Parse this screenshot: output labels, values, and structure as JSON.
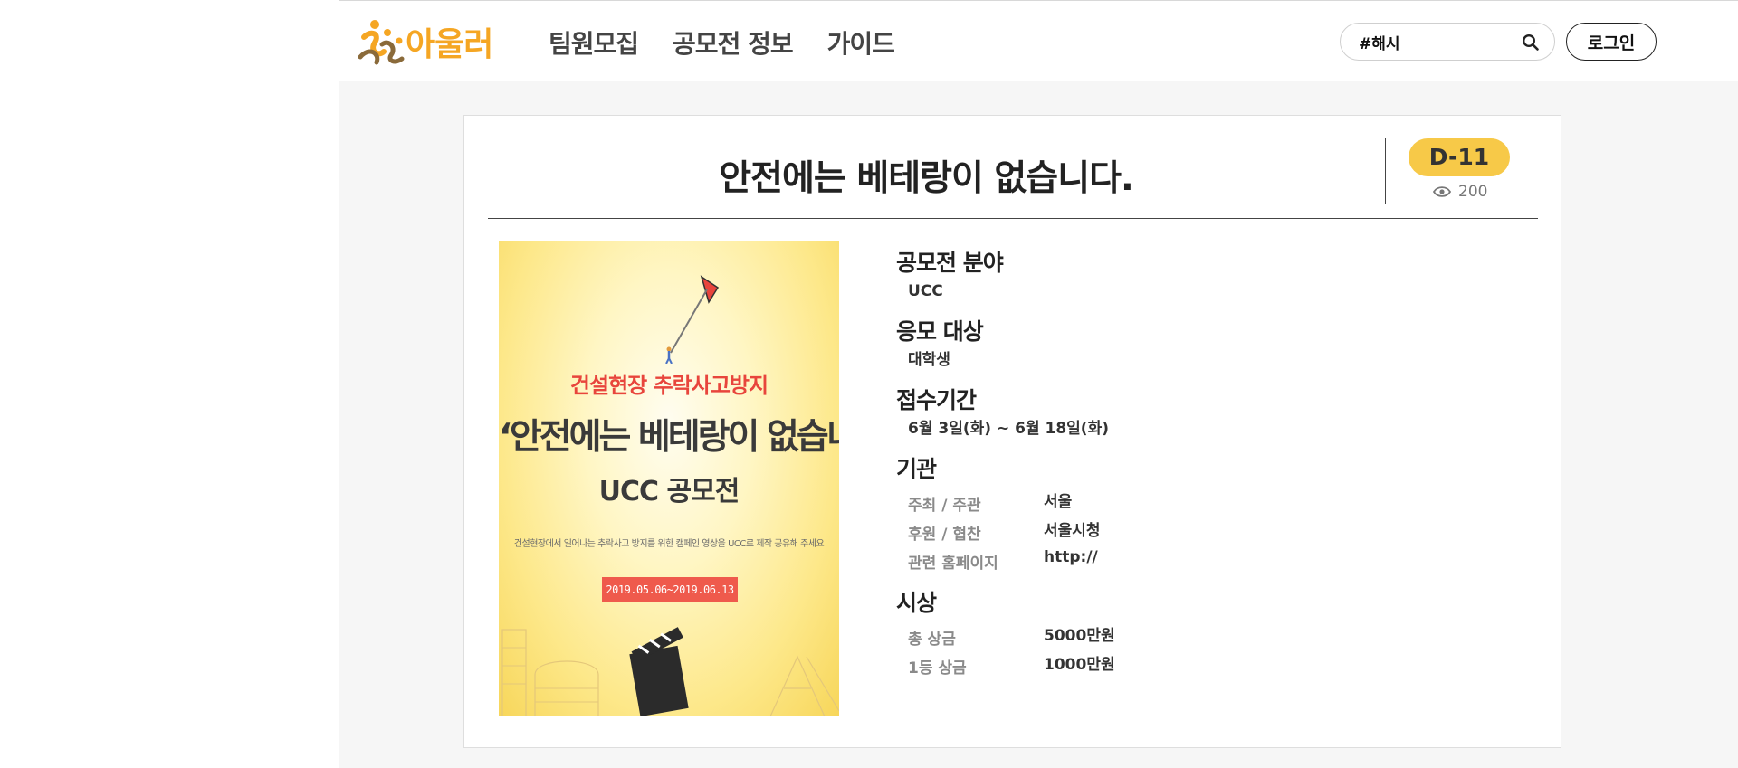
{
  "header": {
    "logo_text": "아울러",
    "nav": [
      "팀원모집",
      "공모전 정보",
      "가이드"
    ],
    "search": {
      "value": "#해시",
      "placeholder": "#해시"
    },
    "login_label": "로그인"
  },
  "contest": {
    "title": "안전에는 베테랑이 없습니다.",
    "dday": "D-11",
    "views": "200",
    "poster": {
      "subtitle": "건설현장 추락사고방지",
      "headline": "‘안전에는 베테랑이 없습니다’",
      "event": "UCC 공모전",
      "description": "건설현장에서 일어나는 추락사고 방지를 위한 캠페인 영상을 UCC로 제작 공유해 주세요",
      "period": "2019.05.06~2019.06.13"
    },
    "field": {
      "heading": "공모전 분야",
      "value": "UCC"
    },
    "target": {
      "heading": "응모 대상",
      "value": "대학생"
    },
    "period": {
      "heading": "접수기간",
      "value": "6월 3일(화) ~ 6월 18일(화)"
    },
    "organization": {
      "heading": "기관",
      "rows": [
        {
          "label": "주최 / 주관",
          "value": "서울"
        },
        {
          "label": "후원 / 협찬",
          "value": "서울시청"
        },
        {
          "label": "관련 홈페이지",
          "value": "http://"
        }
      ]
    },
    "awards": {
      "heading": "시상",
      "rows": [
        {
          "label": "총 상금",
          "value": "5000만원"
        },
        {
          "label": "1등 상금",
          "value": "1000만원"
        }
      ]
    }
  },
  "colors": {
    "brand": "#f5a623",
    "badge": "#f7c948",
    "ribbon": "#ef5a4c"
  }
}
